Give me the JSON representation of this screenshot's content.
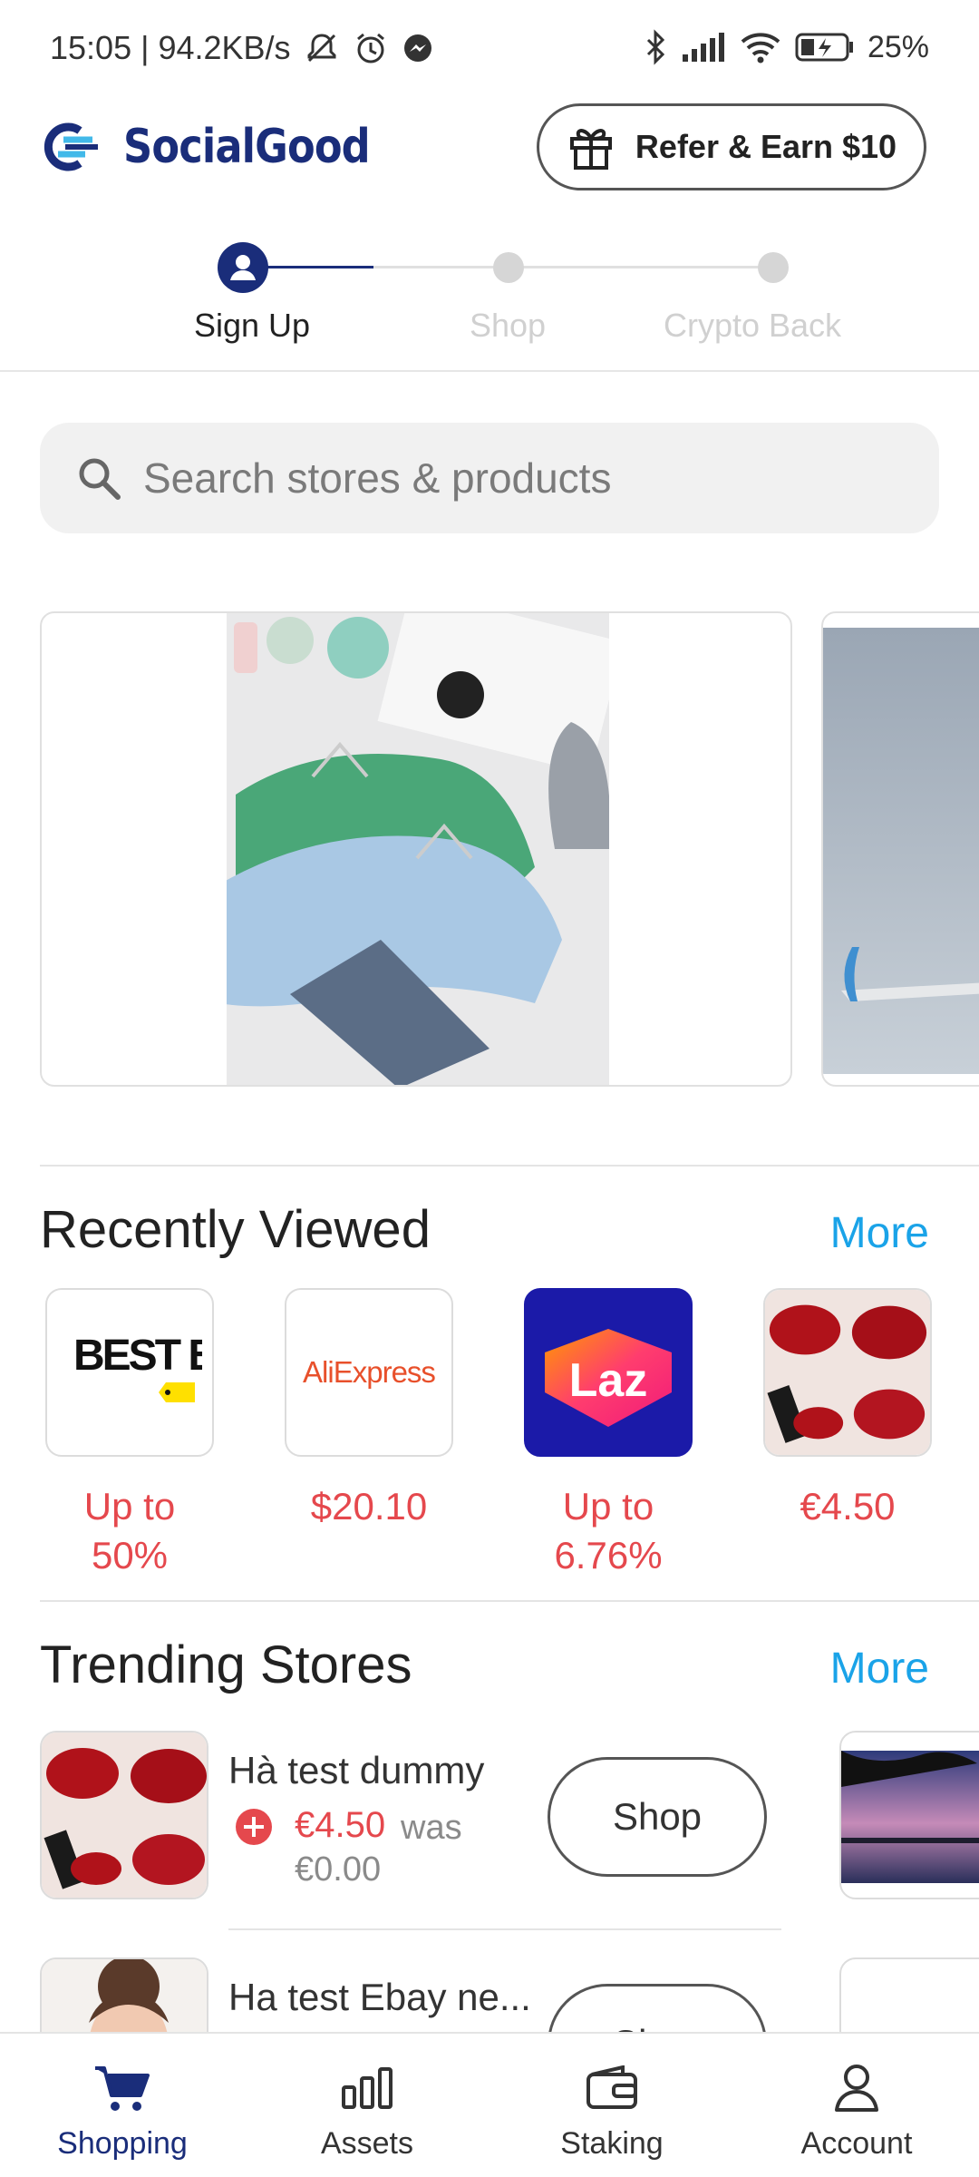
{
  "status_bar": {
    "time_speed": "15:05 | 94.2KB/s",
    "battery": "25%"
  },
  "header": {
    "app_name": "SocialGood",
    "refer_label": "Refer & Earn $10",
    "brand_color": "#1a2d7a",
    "accent_color": "#42b9e9"
  },
  "stepper": {
    "steps": [
      {
        "label": "Sign Up",
        "active": true
      },
      {
        "label": "Shop",
        "active": false
      },
      {
        "label": "Crypto Back",
        "active": false
      }
    ]
  },
  "search": {
    "placeholder": "Search stores & products",
    "icon": "search-icon"
  },
  "banners": [
    {
      "image": "clothing-flatlay"
    },
    {
      "image": "airplane-wing-sky"
    }
  ],
  "recently_viewed": {
    "title": "Recently Viewed",
    "more": "More",
    "items": [
      {
        "store": "BEST BUY",
        "price": "Up to 50%"
      },
      {
        "store": "AliExpress",
        "price": "$20.10"
      },
      {
        "store": "Laz",
        "price": "Up to 6.76%"
      },
      {
        "store": "lipstick-product",
        "price": "€4.50"
      }
    ]
  },
  "trending": {
    "title": "Trending Stores",
    "more": "More",
    "items": [
      {
        "name": "Hà test dummy",
        "price": "€4.50",
        "was": "was",
        "old_price": "€0.00",
        "button": "Shop"
      },
      {
        "name": "Ha test Ebay ne...",
        "button": "Shop"
      }
    ]
  },
  "bottom_nav": {
    "items": [
      {
        "label": "Shopping",
        "icon": "cart-icon",
        "active": true
      },
      {
        "label": "Assets",
        "icon": "bar-chart-icon",
        "active": false
      },
      {
        "label": "Staking",
        "icon": "wallet-icon",
        "active": false
      },
      {
        "label": "Account",
        "icon": "person-icon",
        "active": false
      }
    ]
  }
}
